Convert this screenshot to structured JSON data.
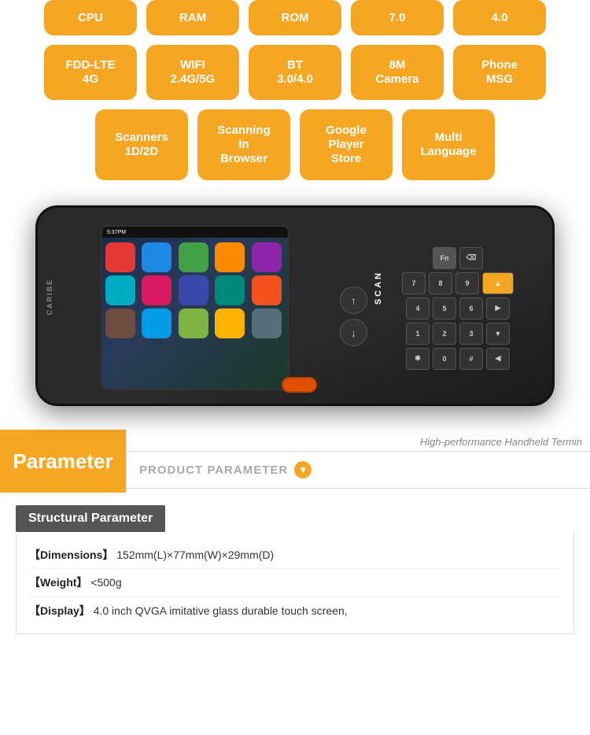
{
  "specs": {
    "row1": [
      {
        "label": "CPU"
      },
      {
        "label": "RAM"
      },
      {
        "label": "ROM"
      },
      {
        "label": "7.0"
      },
      {
        "label": "4.0"
      }
    ],
    "row2": [
      {
        "label": "FDD-LTE\n4G"
      },
      {
        "label": "WIFI\n2.4G/5G"
      },
      {
        "label": "BT\n3.0/4.0"
      },
      {
        "label": "8M\nCamera"
      },
      {
        "label": "Phone\nMSG"
      }
    ],
    "row3": [
      {
        "label": "Scanners\n1D/2D"
      },
      {
        "label": "Scanning\nIn\nBrowser"
      },
      {
        "label": "Google\nPlayer\nStore"
      },
      {
        "label": "Multi\nLanguage"
      }
    ]
  },
  "device": {
    "brand": "CARIBE",
    "scan_label": "SCAN"
  },
  "parameter": {
    "title": "Parameter",
    "high_perf_text": "High-performance Handheld Termin",
    "product_param_label": "PRODUCT PARAMETER"
  },
  "structural": {
    "header": "Structural Parameter",
    "rows": [
      {
        "key": "【Dimensions】",
        "value": "152mm(L)×77mm(W)×29mm(D)"
      },
      {
        "key": "【Weight】",
        "value": "<500g"
      },
      {
        "key": "【Display】",
        "value": "4.0 inch QVGA imitative glass durable touch screen,"
      }
    ]
  },
  "app_colors": [
    "#e53935",
    "#43a047",
    "#1e88e5",
    "#fb8c00",
    "#8e24aa",
    "#00acc1",
    "#d81b60",
    "#3949ab",
    "#00897b",
    "#f4511e",
    "#6d4c41",
    "#039be5",
    "#7cb342",
    "#ffb300",
    "#546e7a"
  ]
}
